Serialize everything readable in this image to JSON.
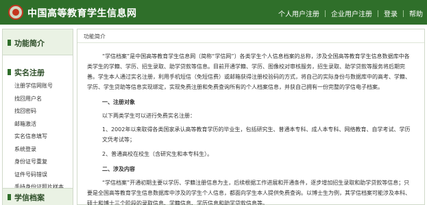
{
  "header": {
    "site_title": "中国高等教育学生信息网",
    "nav": [
      "个人用户注册",
      "企业用户注册",
      "登录",
      "帮助"
    ]
  },
  "sidebar": {
    "intro_title": "功能简介",
    "realname_title": "实名注册",
    "items": [
      "注册学信网账号",
      "找回用户名",
      "找回密码",
      "邮箱激活",
      "实名信息填写",
      "系统登录",
      "身份证号重复",
      "证件号码错误",
      "手持身份证照片样本"
    ],
    "archive_title": "学信档案"
  },
  "main": {
    "header_label": "功能简介",
    "intro": "“学信档案”是中国高等教育学生信息网（简称“学信网”）各类学生个人信息档案的总称，涉及全国高等教育学生信息数据库中各类学生的学籍、学历、招生录取、助学贷款等信息。目前开通学籍、学历、图像校对审核服务，招生录取、助学贷款等服务将后期完善。学生本人通过实名注册，利用手机短信（免短信费）或邮箱获得注册校验码的方式，将自己的实际身份与数据库中的高考、学籍、学历、学生贷助等信息实现绑定，实现免费注册和免费查询所有的个人档案信息，并获自己拥有一份完整的学信电子档案。",
    "section1_title": "一、注册对象",
    "section1_lead": "以下两类学生可以进行免费实名注册：",
    "section1_item1": "1、2002年以来取得各类国家承认高等教育学历的毕业生，包括研究生、普通本专科、成人本专科、网络教育、自学考试、学历文凭考试等；",
    "section1_item2": "2、普通高校在校生（含研究生和本专科生）。",
    "section2_title": "二、涉及内容",
    "section2_text": "“学信档案”开通初期主要以学历、学籍注册信息为主，后续根据工作进展和开通条件，逐步增加招生录取和助学贷款等信息；只要是全国高等教育学生信息数据库中涉及的学生个人信息，都面向学生本人提供免费查询。以博士生为例，其学信档案可能涉及本科、硕士和博士三个阶段的录取信息、学籍信息、学历信息和助学贷款信息等。"
  }
}
